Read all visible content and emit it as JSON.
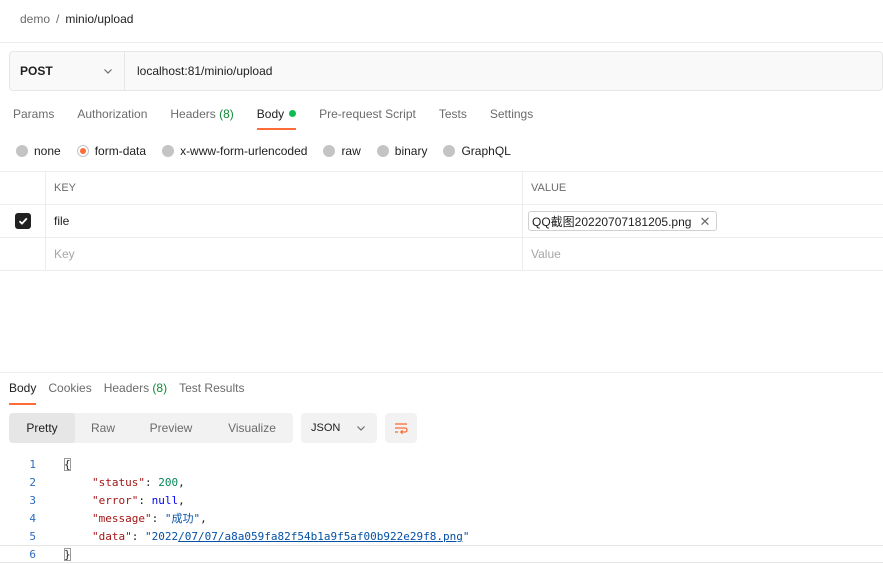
{
  "breadcrumb": {
    "parent": "demo",
    "separator": "/",
    "current": "minio/upload"
  },
  "request": {
    "method": "POST",
    "url": "localhost:81/minio/upload"
  },
  "request_tabs": [
    {
      "label": "Params"
    },
    {
      "label": "Authorization"
    },
    {
      "label": "Headers",
      "count": "(8)"
    },
    {
      "label": "Body",
      "active": true
    },
    {
      "label": "Pre-request Script"
    },
    {
      "label": "Tests"
    },
    {
      "label": "Settings"
    }
  ],
  "body_types": [
    "none",
    "form-data",
    "x-www-form-urlencoded",
    "raw",
    "binary",
    "GraphQL"
  ],
  "body_type_selected": "form-data",
  "form_table": {
    "headers": {
      "key": "KEY",
      "value": "VALUE"
    },
    "rows": [
      {
        "checked": true,
        "key": "file",
        "value": "QQ截图20220707181205.png"
      }
    ],
    "placeholder": {
      "key": "Key",
      "value": "Value"
    }
  },
  "response_tabs": [
    {
      "label": "Body",
      "active": true
    },
    {
      "label": "Cookies"
    },
    {
      "label": "Headers",
      "count": "(8)"
    },
    {
      "label": "Test Results"
    }
  ],
  "view_modes": [
    "Pretty",
    "Raw",
    "Preview",
    "Visualize"
  ],
  "view_mode_selected": "Pretty",
  "response_format": "JSON",
  "response_lines": {
    "l1": "1",
    "l2": "2",
    "l3": "3",
    "l4": "4",
    "l5": "5",
    "l6": "6",
    "open_brace": "{",
    "close_brace": "}",
    "status_key": "\"status\"",
    "status_val": "200",
    "error_key": "\"error\"",
    "error_val": "null",
    "message_key": "\"message\"",
    "message_val": "\"成功\"",
    "data_key": "\"data\"",
    "data_val": "2022/07/07/a8a059fa82f54b1a9f5af00b922e29f8.png"
  },
  "colors": {
    "accent": "#ff6c37",
    "green": "#0cbb52"
  },
  "icons": [
    "chevron-down-icon",
    "check-icon",
    "close-icon",
    "wrap-lines-icon"
  ]
}
